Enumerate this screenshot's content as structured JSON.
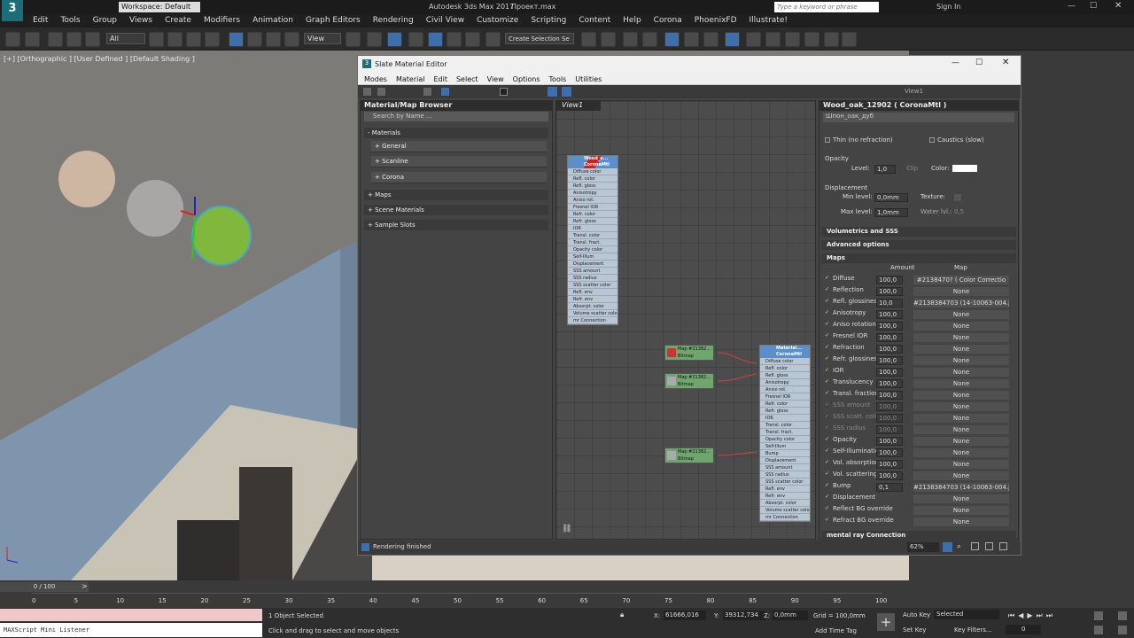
{
  "title_bar": {
    "workspace": "Workspace: Default",
    "app_title": "Autodesk 3ds Max 2017",
    "file_name": "Проект.max",
    "search_placeholder": "Type a keyword or phrase",
    "sign_in": "Sign In"
  },
  "menu": [
    "Edit",
    "Tools",
    "Group",
    "Views",
    "Create",
    "Modifiers",
    "Animation",
    "Graph Editors",
    "Rendering",
    "Civil View",
    "Customize",
    "Scripting",
    "Content",
    "Help",
    "Corona",
    "PhoenixFD",
    "Illustrate!"
  ],
  "toolbar": {
    "filter": "All",
    "ref_coord": "View",
    "selection_set": "Create Selection Se"
  },
  "viewport": {
    "label": "[+] [Orthographic ] [User Defined ] [Default Shading ]"
  },
  "sme": {
    "title": "Slate Material Editor",
    "menu": [
      "Modes",
      "Material",
      "Edit",
      "Select",
      "View",
      "Options",
      "Tools",
      "Utilities"
    ],
    "view_dropdown": "View1",
    "browser": {
      "title": "Material/Map Browser",
      "search_placeholder": "Search by Name ...",
      "sections": [
        "- Materials",
        "+ Maps",
        "+ Scene Materials",
        "+ Sample Slots"
      ],
      "material_groups": [
        "+ General",
        "+ Scanline",
        "+ Corona"
      ]
    },
    "view_tab": "View1",
    "status": "Rendering finished",
    "zoom": "62%"
  },
  "node_main": {
    "title": "Wood_o... CoronaMtl",
    "slots": [
      "Diffuse color",
      "Refl. color",
      "Refl. gloss",
      "Anisotropy",
      "Aniso rot.",
      "Fresnel IOR",
      "Refr. color",
      "Refr. gloss",
      "IOR",
      "Transl. color",
      "Transl. fract.",
      "Opacity color",
      "Self-Illum",
      "Displacement",
      "SSS amount",
      "SSS radius",
      "SSS scatter color",
      "Refl. env",
      "Refr. env",
      "Absorpt. color",
      "Volume scatter color",
      "mr Connection"
    ]
  },
  "node_second": {
    "title": "Material... CoronaMtl",
    "slots": [
      "Diffuse color",
      "Refl. color",
      "Refl. gloss",
      "Anisotropy",
      "Aniso rot.",
      "Fresnel IOR",
      "Refr. color",
      "Refr. gloss",
      "IOR",
      "Transl. color",
      "Transl. fract.",
      "Opacity color",
      "Self-Illum",
      "Bump",
      "Displacement",
      "SSS amount",
      "SSS radius",
      "SSS scatter color",
      "Refl. env",
      "Refr. env",
      "Absorpt. color",
      "Volume scatter color",
      "mr Connection"
    ]
  },
  "map_nodes": [
    "Map #21382... Bitmap",
    "Map #21382... Bitmap",
    "Map #21382... Bitmap"
  ],
  "props": {
    "header": "Wood_oak_12902 ( CoronaMtl )",
    "name_field": "Шпон_оак_дуб",
    "thin_label": "Thin (no refraction)",
    "caustics_label": "Caustics (slow)",
    "opacity": {
      "title": "Opacity",
      "level_label": "Level:",
      "level": "1,0",
      "clip_label": "Clip",
      "color_label": "Color:"
    },
    "displacement": {
      "title": "Displacement",
      "min_label": "Min level:",
      "min": "0,0mm",
      "texture_label": "Texture:",
      "max_label": "Max level:",
      "max": "1,0mm",
      "water_label": "Water lvl.:",
      "water": "0,5"
    },
    "rollouts": [
      "Volumetrics and SSS",
      "Advanced options",
      "Maps"
    ],
    "maps_header": {
      "amount": "Amount",
      "map": "Map"
    },
    "maps": [
      {
        "name": "Diffuse",
        "amount": "100,0",
        "map": "#2138470? ( Color Correctio"
      },
      {
        "name": "Reflection",
        "amount": "100,0",
        "map": "None"
      },
      {
        "name": "Refl. glossiness",
        "amount": "10,0",
        "map": "#2138384703 (14-10063-004.j"
      },
      {
        "name": "Anisotropy",
        "amount": "100,0",
        "map": "None"
      },
      {
        "name": "Aniso rotation",
        "amount": "100,0",
        "map": "None"
      },
      {
        "name": "Fresnel IOR",
        "amount": "100,0",
        "map": "None"
      },
      {
        "name": "Refraction",
        "amount": "100,0",
        "map": "None"
      },
      {
        "name": "Refr. glossiness",
        "amount": "100,0",
        "map": "None"
      },
      {
        "name": "IOR",
        "amount": "100,0",
        "map": "None"
      },
      {
        "name": "Translucency",
        "amount": "100,0",
        "map": "None"
      },
      {
        "name": "Transl. fraction",
        "amount": "100,0",
        "map": "None"
      },
      {
        "name": "SSS amount",
        "amount": "100,0",
        "map": "None"
      },
      {
        "name": "SSS scatt. color",
        "amount": "100,0",
        "map": "None"
      },
      {
        "name": "SSS radius",
        "amount": "100,0",
        "map": "None"
      },
      {
        "name": "Opacity",
        "amount": "100,0",
        "map": "None"
      },
      {
        "name": "Self-Illumination",
        "amount": "100,0",
        "map": "None"
      },
      {
        "name": "Vol. absorption",
        "amount": "100,0",
        "map": "None"
      },
      {
        "name": "Vol. scattering",
        "amount": "100,0",
        "map": "None"
      },
      {
        "name": "Bump",
        "amount": "0,1",
        "map": "#2138384703 (14-10063-004.j"
      },
      {
        "name": "Displacement",
        "amount": "",
        "map": "None"
      },
      {
        "name": "Reflect BG override",
        "amount": "",
        "map": "None"
      },
      {
        "name": "Refract BG override",
        "amount": "",
        "map": "None"
      }
    ],
    "mr_connection": "mental ray Connection"
  },
  "timeline": {
    "frame": "0 / 100",
    "ticks": [
      "0",
      "5",
      "10",
      "15",
      "20",
      "25",
      "30",
      "35",
      "40",
      "45",
      "50",
      "55",
      "60",
      "65",
      "70",
      "75",
      "80",
      "85",
      "90",
      "95",
      "100"
    ]
  },
  "status": {
    "script_listener": "MAXScript Mini Listener",
    "selected": "1 Object Selected",
    "prompt": "Click and drag to select and move objects",
    "x_label": "X:",
    "x": "61666,016",
    "y_label": "Y:",
    "y": "39312,734",
    "z_label": "Z:",
    "z": "0,0mm",
    "grid": "Grid = 100,0mm",
    "add_time_tag": "Add Time Tag",
    "auto_key": "Auto Key",
    "set_key": "Set Key",
    "key_mode": "Selected",
    "key_filters": "Key Filters...",
    "frame_field": "0"
  }
}
